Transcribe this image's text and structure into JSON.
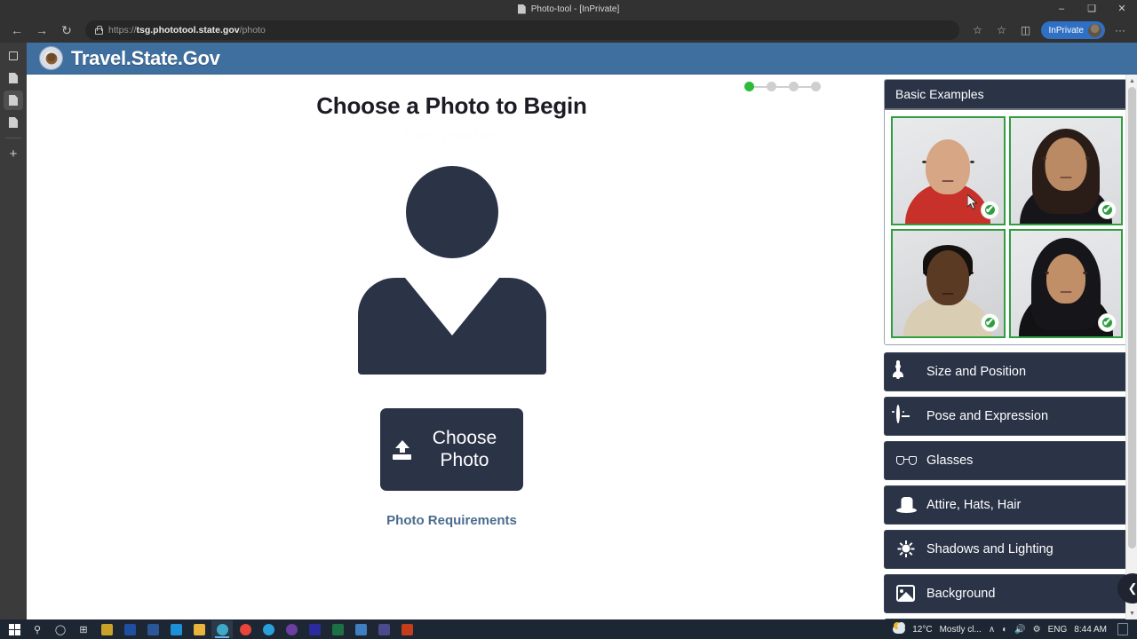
{
  "browser": {
    "tab_title": "Photo-tool - [InPrivate]",
    "url_scheme": "https://",
    "url_host": "tsg.phototool.state.gov",
    "url_path": "/photo",
    "inprivate_label": "InPrivate",
    "window_minimize": "–",
    "window_maximize": "❑",
    "window_close": "✕",
    "nav_back": "←",
    "nav_forward": "→",
    "nav_reload": "↻",
    "toolbar_icons": [
      "favorites-star-icon",
      "collections-icon",
      "browser-essentials-icon",
      "settings-more-icon"
    ],
    "more_glyph": "···",
    "tabstrip_plus": "+"
  },
  "site": {
    "title": "Travel.State.Gov",
    "header_color": "#3f6f9e"
  },
  "main": {
    "page_title": "Choose a Photo to Begin",
    "ghost_text": "Drag a photo here",
    "choose_button_label": "Choose Photo",
    "requirements_link": "Photo Requirements",
    "progress": {
      "total": 4,
      "active_index": 0,
      "active_color": "#2ebb3a",
      "inactive_color": "#cfcfcf"
    }
  },
  "sidebar": {
    "examples_title": "Basic Examples",
    "check_glyph": "✔",
    "examples": [
      {
        "name": "example-photo-1",
        "approved": true
      },
      {
        "name": "example-photo-2",
        "approved": true
      },
      {
        "name": "example-photo-3",
        "approved": true
      },
      {
        "name": "example-photo-4",
        "approved": true
      }
    ],
    "sections": [
      {
        "label": "Size and Position",
        "icon": "portrait-frame-icon"
      },
      {
        "label": "Pose and Expression",
        "icon": "neutral-face-icon"
      },
      {
        "label": "Glasses",
        "icon": "glasses-icon"
      },
      {
        "label": "Attire, Hats, Hair",
        "icon": "top-hat-icon"
      },
      {
        "label": "Shadows and Lighting",
        "icon": "sun-icon"
      },
      {
        "label": "Background",
        "icon": "image-icon"
      }
    ]
  },
  "taskbar": {
    "weather_temp": "12°C",
    "weather_desc": "Mostly cl...",
    "language": "ENG",
    "clock": "8:44 AM",
    "chevron": "∧",
    "wifi_glyph": "◠",
    "volume_glyph": "ᵈ))",
    "apps": [
      {
        "name": "start-button",
        "color": "#ffffff"
      },
      {
        "name": "search-icon",
        "color": "#d9d9d9"
      },
      {
        "name": "cortana-icon",
        "color": "#d9d9d9"
      },
      {
        "name": "task-view-icon",
        "color": "#d9d9d9"
      },
      {
        "name": "store-icon",
        "color": "#c9a227"
      },
      {
        "name": "office-icon",
        "color": "#1f4fa0"
      },
      {
        "name": "word-icon",
        "color": "#2b579a"
      },
      {
        "name": "mail-icon",
        "color": "#1e90d8"
      },
      {
        "name": "file-explorer-icon",
        "color": "#e8b43c"
      },
      {
        "name": "edge-icon",
        "color": "#3fa9c7"
      },
      {
        "name": "chrome-icon",
        "color": "#e8453c"
      },
      {
        "name": "telegram-icon",
        "color": "#29a0db"
      },
      {
        "name": "photoshop-icon",
        "color": "#6a3fa0"
      },
      {
        "name": "audition-icon",
        "color": "#2b2b9e"
      },
      {
        "name": "excel-icon",
        "color": "#1d7044"
      },
      {
        "name": "photos-icon",
        "color": "#3f7fc1"
      },
      {
        "name": "music-icon",
        "color": "#4a4a8c"
      },
      {
        "name": "powerpoint-icon",
        "color": "#c43e1c"
      }
    ]
  }
}
